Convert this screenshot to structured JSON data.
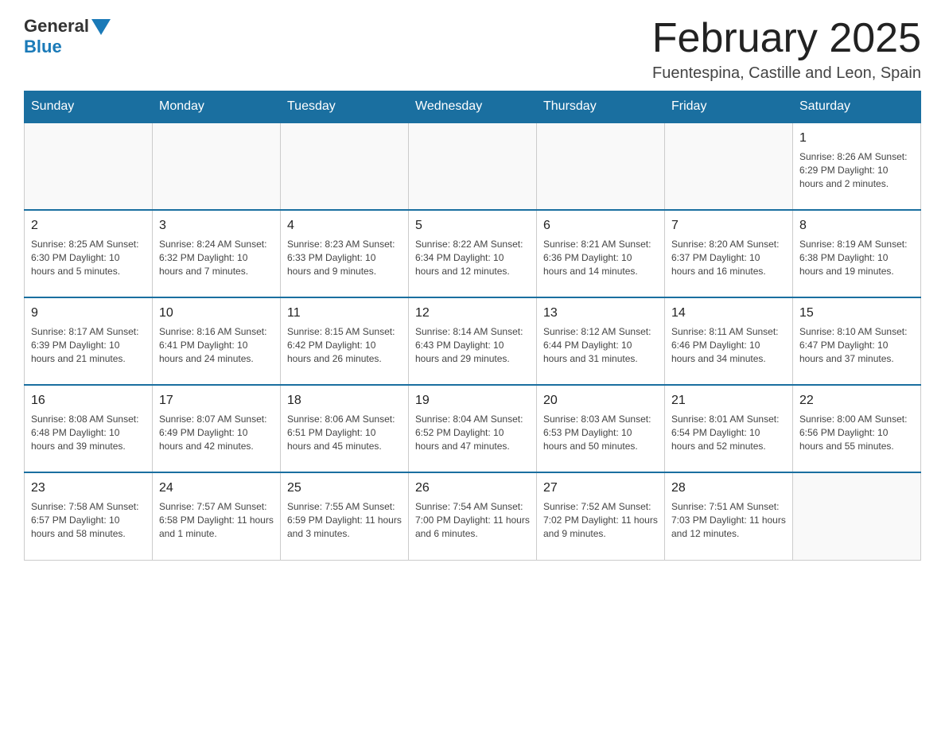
{
  "header": {
    "logo_general": "General",
    "logo_blue": "Blue",
    "title": "February 2025",
    "subtitle": "Fuentespina, Castille and Leon, Spain"
  },
  "days_of_week": [
    "Sunday",
    "Monday",
    "Tuesday",
    "Wednesday",
    "Thursday",
    "Friday",
    "Saturday"
  ],
  "weeks": [
    [
      {
        "day": "",
        "info": ""
      },
      {
        "day": "",
        "info": ""
      },
      {
        "day": "",
        "info": ""
      },
      {
        "day": "",
        "info": ""
      },
      {
        "day": "",
        "info": ""
      },
      {
        "day": "",
        "info": ""
      },
      {
        "day": "1",
        "info": "Sunrise: 8:26 AM\nSunset: 6:29 PM\nDaylight: 10 hours and 2 minutes."
      }
    ],
    [
      {
        "day": "2",
        "info": "Sunrise: 8:25 AM\nSunset: 6:30 PM\nDaylight: 10 hours and 5 minutes."
      },
      {
        "day": "3",
        "info": "Sunrise: 8:24 AM\nSunset: 6:32 PM\nDaylight: 10 hours and 7 minutes."
      },
      {
        "day": "4",
        "info": "Sunrise: 8:23 AM\nSunset: 6:33 PM\nDaylight: 10 hours and 9 minutes."
      },
      {
        "day": "5",
        "info": "Sunrise: 8:22 AM\nSunset: 6:34 PM\nDaylight: 10 hours and 12 minutes."
      },
      {
        "day": "6",
        "info": "Sunrise: 8:21 AM\nSunset: 6:36 PM\nDaylight: 10 hours and 14 minutes."
      },
      {
        "day": "7",
        "info": "Sunrise: 8:20 AM\nSunset: 6:37 PM\nDaylight: 10 hours and 16 minutes."
      },
      {
        "day": "8",
        "info": "Sunrise: 8:19 AM\nSunset: 6:38 PM\nDaylight: 10 hours and 19 minutes."
      }
    ],
    [
      {
        "day": "9",
        "info": "Sunrise: 8:17 AM\nSunset: 6:39 PM\nDaylight: 10 hours and 21 minutes."
      },
      {
        "day": "10",
        "info": "Sunrise: 8:16 AM\nSunset: 6:41 PM\nDaylight: 10 hours and 24 minutes."
      },
      {
        "day": "11",
        "info": "Sunrise: 8:15 AM\nSunset: 6:42 PM\nDaylight: 10 hours and 26 minutes."
      },
      {
        "day": "12",
        "info": "Sunrise: 8:14 AM\nSunset: 6:43 PM\nDaylight: 10 hours and 29 minutes."
      },
      {
        "day": "13",
        "info": "Sunrise: 8:12 AM\nSunset: 6:44 PM\nDaylight: 10 hours and 31 minutes."
      },
      {
        "day": "14",
        "info": "Sunrise: 8:11 AM\nSunset: 6:46 PM\nDaylight: 10 hours and 34 minutes."
      },
      {
        "day": "15",
        "info": "Sunrise: 8:10 AM\nSunset: 6:47 PM\nDaylight: 10 hours and 37 minutes."
      }
    ],
    [
      {
        "day": "16",
        "info": "Sunrise: 8:08 AM\nSunset: 6:48 PM\nDaylight: 10 hours and 39 minutes."
      },
      {
        "day": "17",
        "info": "Sunrise: 8:07 AM\nSunset: 6:49 PM\nDaylight: 10 hours and 42 minutes."
      },
      {
        "day": "18",
        "info": "Sunrise: 8:06 AM\nSunset: 6:51 PM\nDaylight: 10 hours and 45 minutes."
      },
      {
        "day": "19",
        "info": "Sunrise: 8:04 AM\nSunset: 6:52 PM\nDaylight: 10 hours and 47 minutes."
      },
      {
        "day": "20",
        "info": "Sunrise: 8:03 AM\nSunset: 6:53 PM\nDaylight: 10 hours and 50 minutes."
      },
      {
        "day": "21",
        "info": "Sunrise: 8:01 AM\nSunset: 6:54 PM\nDaylight: 10 hours and 52 minutes."
      },
      {
        "day": "22",
        "info": "Sunrise: 8:00 AM\nSunset: 6:56 PM\nDaylight: 10 hours and 55 minutes."
      }
    ],
    [
      {
        "day": "23",
        "info": "Sunrise: 7:58 AM\nSunset: 6:57 PM\nDaylight: 10 hours and 58 minutes."
      },
      {
        "day": "24",
        "info": "Sunrise: 7:57 AM\nSunset: 6:58 PM\nDaylight: 11 hours and 1 minute."
      },
      {
        "day": "25",
        "info": "Sunrise: 7:55 AM\nSunset: 6:59 PM\nDaylight: 11 hours and 3 minutes."
      },
      {
        "day": "26",
        "info": "Sunrise: 7:54 AM\nSunset: 7:00 PM\nDaylight: 11 hours and 6 minutes."
      },
      {
        "day": "27",
        "info": "Sunrise: 7:52 AM\nSunset: 7:02 PM\nDaylight: 11 hours and 9 minutes."
      },
      {
        "day": "28",
        "info": "Sunrise: 7:51 AM\nSunset: 7:03 PM\nDaylight: 11 hours and 12 minutes."
      },
      {
        "day": "",
        "info": ""
      }
    ]
  ]
}
